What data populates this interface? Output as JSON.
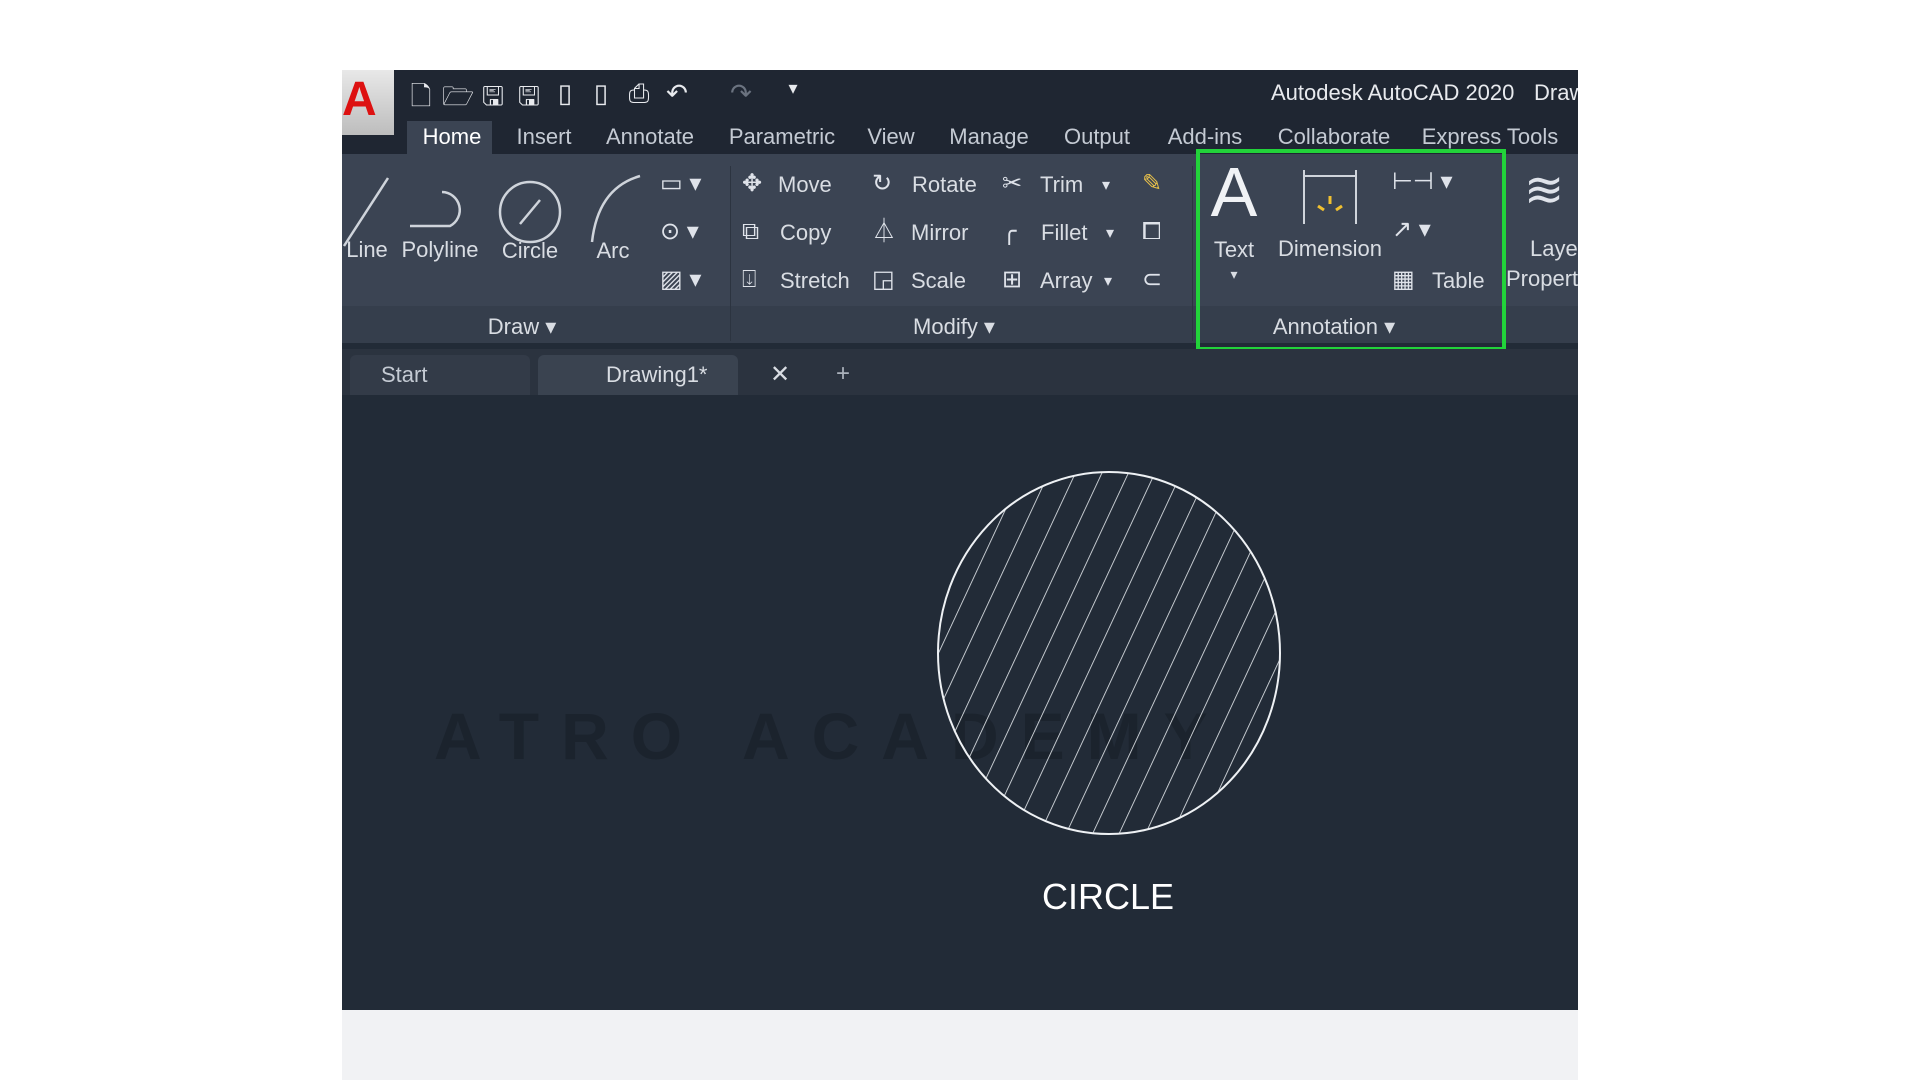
{
  "app": {
    "logo": "A",
    "title": "Autodesk AutoCAD 2020",
    "title_suffix": "Draw"
  },
  "quick_access": [
    "new-icon",
    "open-icon",
    "save-icon",
    "save-as-icon",
    "open-web-icon",
    "share-icon",
    "plot-icon",
    "undo-icon",
    "redo-icon",
    "customize-icon"
  ],
  "ribbon_tabs": [
    {
      "label": "Home",
      "active": true
    },
    {
      "label": "Insert"
    },
    {
      "label": "Annotate"
    },
    {
      "label": "Parametric"
    },
    {
      "label": "View"
    },
    {
      "label": "Manage"
    },
    {
      "label": "Output"
    },
    {
      "label": "Add-ins"
    },
    {
      "label": "Collaborate"
    },
    {
      "label": "Express Tools"
    }
  ],
  "draw": {
    "label": "Draw",
    "tools": {
      "line": "Line",
      "polyline": "Polyline",
      "circle": "Circle",
      "arc": "Arc"
    }
  },
  "modify": {
    "label": "Modify",
    "tools": {
      "move": "Move",
      "rotate": "Rotate",
      "trim": "Trim",
      "copy": "Copy",
      "mirror": "Mirror",
      "fillet": "Fillet",
      "stretch": "Stretch",
      "scale": "Scale",
      "array": "Array"
    }
  },
  "annotation": {
    "label": "Annotation",
    "tools": {
      "text": "Text",
      "dimension": "Dimension",
      "table": "Table"
    }
  },
  "layers": {
    "label": "Layer",
    "label2": "Propert"
  },
  "file_tabs": {
    "start": "Start",
    "drawing": "Drawing1*"
  },
  "canvas": {
    "caption": "CIRCLE",
    "watermark": "ATRO ACADEMY"
  },
  "colors": {
    "highlight": "#22d33a",
    "background": "#222b37",
    "ribbon": "#3b4453"
  }
}
